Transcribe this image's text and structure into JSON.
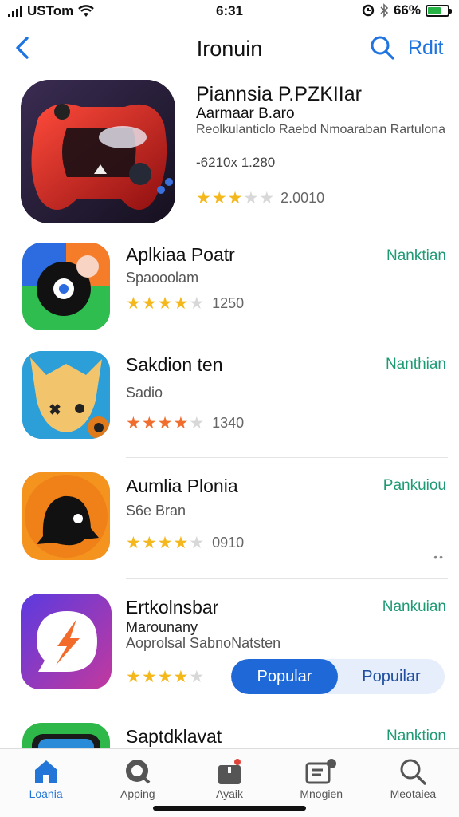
{
  "status_bar": {
    "carrier": "USTom",
    "time": "6:31",
    "battery": "66%",
    "battery_level": 0.66
  },
  "nav": {
    "title": "Ironuin",
    "action_label": "Rdit"
  },
  "featured": {
    "title": "Piannsia P.PZKIIar",
    "developer": "Aarmaar B.aro",
    "description": "Reolkulanticlo Raebd Nmoaraban Rartulona",
    "size": "-6210x 1.280",
    "rating": 3,
    "rating_count": "2.0010"
  },
  "apps": [
    {
      "title": "Aplkiaa Poatr",
      "subtitle": "Spaooolam",
      "rating": 3.5,
      "rating_count": "1250",
      "get_label": "Nanktian",
      "icon": "vinyl-record-icon",
      "colors": [
        "#f57d2a",
        "#2c6ce0",
        "#2ebd4e"
      ]
    },
    {
      "title": "Sakdion ten",
      "subtitle": "Sadio",
      "rating": 3.5,
      "rating_count": "1340",
      "get_label": "Nanthian",
      "icon": "cartoon-creature-icon",
      "colors": [
        "#2c9fd9",
        "#f2c46c"
      ]
    },
    {
      "title": "Aumlia Plonia",
      "subtitle": "S6e Bran",
      "rating": 3.5,
      "rating_count": "0910",
      "get_label": "Pankuiou",
      "icon": "ink-blob-character-icon",
      "colors": [
        "#f5931f",
        "#ea5f12"
      ]
    },
    {
      "title": "Ertkolnsbar",
      "subtitle": "Marounany",
      "subtitle2": "Aoprolsal SabnoNatsten",
      "rating": 3.5,
      "get_label": "Nankuian",
      "icon": "lightning-chat-icon",
      "colors": [
        "#7b3fe0",
        "#d54e8f"
      ],
      "toggle": {
        "active": "Popular",
        "inactive": "Popuilar"
      }
    },
    {
      "title": "Saptdklavat",
      "get_label": "Nanktion",
      "icon": "goggles-icon",
      "colors": [
        "#2fb84a",
        "#2a8cd8"
      ]
    }
  ],
  "tabs": [
    {
      "label": "Loania",
      "icon": "home-icon",
      "active": true
    },
    {
      "label": "Apping",
      "icon": "apps-icon",
      "active": false
    },
    {
      "label": "Ayaik",
      "icon": "gift-icon",
      "active": false
    },
    {
      "label": "Mnogien",
      "icon": "updates-icon",
      "active": false
    },
    {
      "label": "Meotaiea",
      "icon": "search-icon",
      "active": false
    }
  ],
  "colors": {
    "accent": "#1f74e0",
    "get": "#1e9a73",
    "star": "#f5b81c"
  }
}
